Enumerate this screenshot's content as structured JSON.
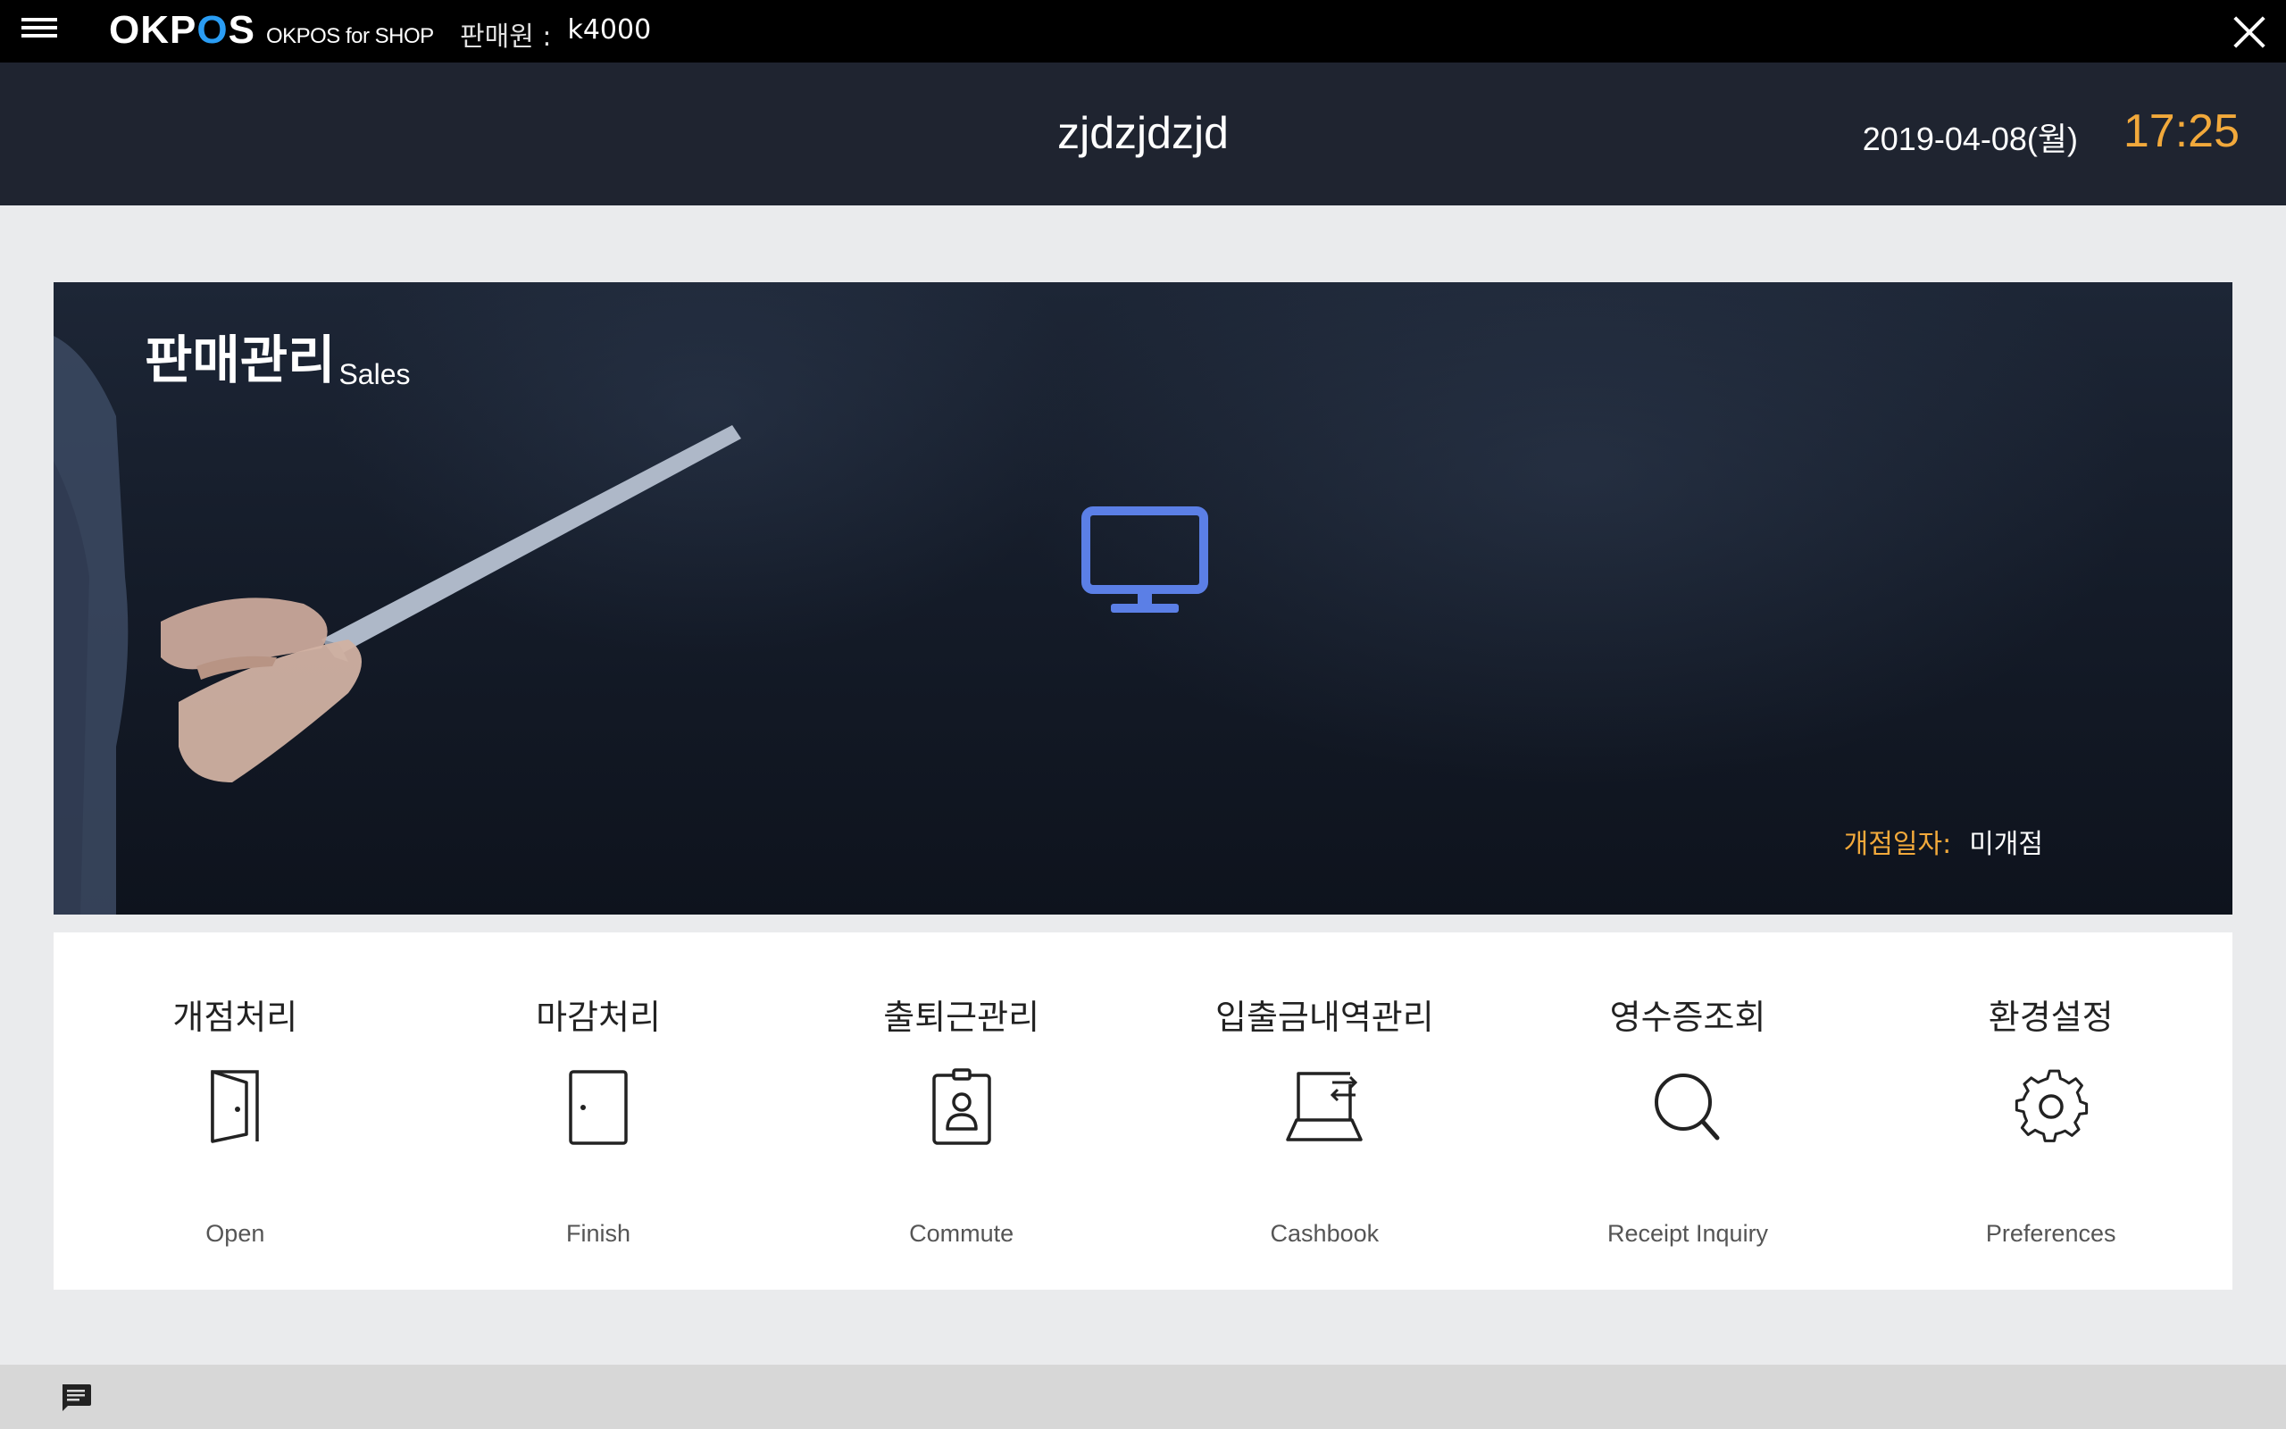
{
  "topbar": {
    "logo_text": "OKPOS",
    "logo_sub": "OKPOS for SHOP",
    "seller_label": "판매원 :",
    "seller_id": "k4000",
    "menu_icon": "hamburger-icon",
    "close_icon": "close-icon"
  },
  "header": {
    "store_name": "zjdzjdzjd",
    "date": "2019-04-08(월)",
    "time": "17:25"
  },
  "banner": {
    "title_ko": "판매관리",
    "title_en": "Sales",
    "icon": "monitor-icon",
    "open_date_label": "개점일자:",
    "open_date_value": "미개점"
  },
  "menu": [
    {
      "ko": "개점처리",
      "en": "Open",
      "icon": "door-open-icon"
    },
    {
      "ko": "마감처리",
      "en": "Finish",
      "icon": "door-closed-icon"
    },
    {
      "ko": "출퇴근관리",
      "en": "Commute",
      "icon": "id-badge-icon"
    },
    {
      "ko": "입출금내역관리",
      "en": "Cashbook",
      "icon": "cashbook-icon"
    },
    {
      "ko": "영수증조회",
      "en": "Receipt Inquiry",
      "icon": "search-icon"
    },
    {
      "ko": "환경설정",
      "en": "Preferences",
      "icon": "gear-icon"
    }
  ],
  "bottombar": {
    "icon": "chat-icon"
  },
  "colors": {
    "accent": "#f2a93b",
    "monitor": "#5b7fe6",
    "header_bg": "#1f2430",
    "logo_blue": "#2a9df4"
  }
}
